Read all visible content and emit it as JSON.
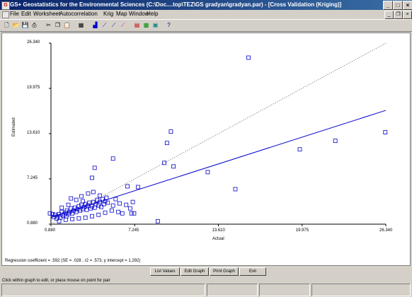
{
  "window": {
    "title": "GS+ Geostatistics for the Environmental Sciences (C:\\Doc....top\\TEZ\\GS gradyan\\gradyan.par) - [Cross Validation (Kriging)]",
    "app_icon": "gs-app-icon",
    "controls": [
      "minimize-icon",
      "maximize-icon",
      "close-icon"
    ]
  },
  "menu": {
    "items": [
      "File",
      "Edit",
      "Worksheet",
      "Autocorrelation",
      "Krig",
      "Map",
      "Window",
      "Help"
    ]
  },
  "toolbar": {
    "icons": [
      "new-file-icon",
      "open-folder-icon",
      "save-disk-icon",
      "print-icon",
      "cut-icon",
      "copy-icon",
      "paste-icon",
      "data-grid-icon",
      "histogram-icon",
      "variogram-icon",
      "anisotropy-icon",
      "cross-variogram-icon",
      "krig-icon",
      "map-icon",
      "map3d-icon",
      "help-icon"
    ]
  },
  "graph": {
    "xlabel": "Actual",
    "ylabel": "Estimated",
    "x_ticks": [
      "0.880",
      "7.245",
      "13.610",
      "19.975",
      "26.340"
    ],
    "y_ticks": [
      "0.880",
      "7.245",
      "13.610",
      "19.975",
      "26.340"
    ],
    "regression_text": "Regression coefficient = .592 (SE = .028 , r2 = .573, y intercept = 1.292)"
  },
  "chart_data": {
    "type": "scatter",
    "title": "",
    "xlabel": "Actual",
    "ylabel": "Estimated",
    "xlim": [
      0.88,
      26.34
    ],
    "ylim": [
      0.88,
      26.34
    ],
    "reference_line": "1:1 dotted",
    "regression": {
      "slope": 0.592,
      "intercept": 1.292
    },
    "colors": {
      "points": "#0000cc",
      "regression": "#0000cc",
      "reference": "#666666"
    },
    "points": [
      [
        0.8,
        2.4
      ],
      [
        1.0,
        2.3
      ],
      [
        1.1,
        1.9
      ],
      [
        1.2,
        2.2
      ],
      [
        1.3,
        1.7
      ],
      [
        1.4,
        2.0
      ],
      [
        1.5,
        2.3
      ],
      [
        1.6,
        1.8
      ],
      [
        1.7,
        2.6
      ],
      [
        1.8,
        2.1
      ],
      [
        1.9,
        2.3
      ],
      [
        2.0,
        2.5
      ],
      [
        2.05,
        2.0
      ],
      [
        2.1,
        2.8
      ],
      [
        2.2,
        2.3
      ],
      [
        2.3,
        2.6
      ],
      [
        2.4,
        3.1
      ],
      [
        2.5,
        2.4
      ],
      [
        2.6,
        2.8
      ],
      [
        2.7,
        3.2
      ],
      [
        2.8,
        2.6
      ],
      [
        2.9,
        3.0
      ],
      [
        3.0,
        3.4
      ],
      [
        3.1,
        2.8
      ],
      [
        3.2,
        3.6
      ],
      [
        3.3,
        3.0
      ],
      [
        3.4,
        3.3
      ],
      [
        3.5,
        3.7
      ],
      [
        3.6,
        2.9
      ],
      [
        3.7,
        3.5
      ],
      [
        3.8,
        3.9
      ],
      [
        3.9,
        3.1
      ],
      [
        4.0,
        3.4
      ],
      [
        4.1,
        4.0
      ],
      [
        4.2,
        3.2
      ],
      [
        4.3,
        3.7
      ],
      [
        4.4,
        4.3
      ],
      [
        4.5,
        3.5
      ],
      [
        4.6,
        4.0
      ],
      [
        4.7,
        3.3
      ],
      [
        4.8,
        4.4
      ],
      [
        4.9,
        3.7
      ],
      [
        5.0,
        4.1
      ],
      [
        5.1,
        4.6
      ],
      [
        5.2,
        3.9
      ],
      [
        1.5,
        1.3
      ],
      [
        2.0,
        1.5
      ],
      [
        2.5,
        1.6
      ],
      [
        3.0,
        1.7
      ],
      [
        3.5,
        1.8
      ],
      [
        4.0,
        2.0
      ],
      [
        4.5,
        2.2
      ],
      [
        5.0,
        2.5
      ],
      [
        5.5,
        2.8
      ],
      [
        5.6,
        3.5
      ],
      [
        5.8,
        4.4
      ],
      [
        6.0,
        2.6
      ],
      [
        6.1,
        3.8
      ],
      [
        6.3,
        2.4
      ],
      [
        6.6,
        3.6
      ],
      [
        6.9,
        3.1
      ],
      [
        7.1,
        4.0
      ],
      [
        7.0,
        2.4
      ],
      [
        2.2,
        3.6
      ],
      [
        2.8,
        4.3
      ],
      [
        3.2,
        4.8
      ],
      [
        3.7,
        5.2
      ],
      [
        4.1,
        5.4
      ],
      [
        4.6,
        4.9
      ],
      [
        1.7,
        3.2
      ],
      [
        2.4,
        4.5
      ],
      [
        3.3,
        4.1
      ],
      [
        6.7,
        6.2
      ],
      [
        7.5,
        6.1
      ],
      [
        7.2,
        2.4
      ],
      [
        4.0,
        7.4
      ],
      [
        4.2,
        8.8
      ],
      [
        5.6,
        10.1
      ],
      [
        9.0,
        1.3
      ],
      [
        9.5,
        9.5
      ],
      [
        9.7,
        12.3
      ],
      [
        10.0,
        13.9
      ],
      [
        10.2,
        9.0
      ],
      [
        12.8,
        8.2
      ],
      [
        14.9,
        5.8
      ],
      [
        15.9,
        24.3
      ],
      [
        19.8,
        11.4
      ],
      [
        22.5,
        12.6
      ],
      [
        26.3,
        13.8
      ]
    ]
  }
}
